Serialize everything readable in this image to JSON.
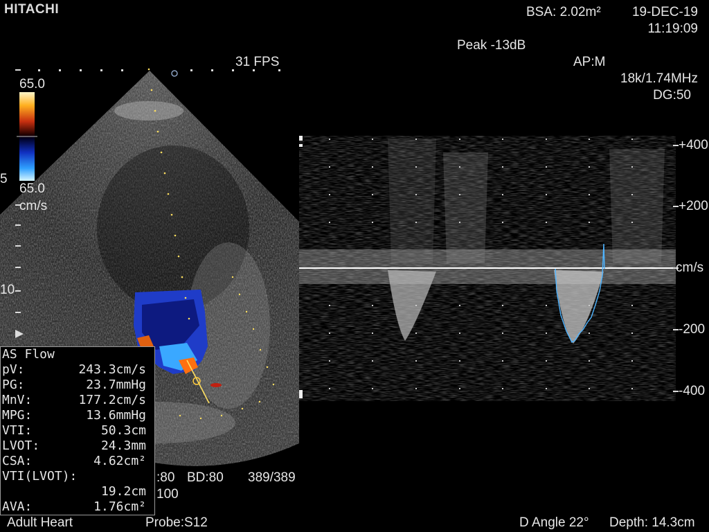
{
  "header": {
    "logo": "HITACHI",
    "bsa": "BSA:  2.02m²",
    "date": "19-DEC-19",
    "time": "11:19:09",
    "peak": "Peak -13dB",
    "fps": "31 FPS",
    "ap": "AP:M",
    "prf": "18k/1.74MHz",
    "dg": "DG:50"
  },
  "color_bar": {
    "top_label": "65.0",
    "bottom_label": "65.0",
    "unit": "cm/s"
  },
  "depth_scale": {
    "label_5": "5",
    "label_10": "10"
  },
  "doppler_axis": {
    "ticks": [
      "+400",
      "+200",
      "cm/s",
      "-200",
      "-400"
    ]
  },
  "measurements": {
    "title": "AS Flow",
    "rows": [
      {
        "label": "pV:",
        "value": "243.3cm/s"
      },
      {
        "label": "PG:",
        "value": "23.7mmHg"
      },
      {
        "label": "MnV:",
        "value": "177.2cm/s"
      },
      {
        "label": "MPG:",
        "value": "13.6mmHg"
      },
      {
        "label": "VTI:",
        "value": "50.3cm"
      },
      {
        "label": "LVOT:",
        "value": "24.3mm"
      },
      {
        "label": "CSA:",
        "value": "4.62cm²"
      },
      {
        "label": "VTI(LVOT):",
        "value": ""
      },
      {
        "label": "",
        "value": "19.2cm"
      },
      {
        "label": "AVA:",
        "value": "1.76cm²"
      }
    ]
  },
  "lower_info": {
    "settings_a": ":80",
    "settings_b": "BD:80",
    "frame": "389/389",
    "settings_c": "100"
  },
  "footer": {
    "mode": "Adult Heart",
    "probe": "Probe:S12",
    "angle": "D Angle 22°",
    "depth": "Depth: 14.3cm"
  }
}
